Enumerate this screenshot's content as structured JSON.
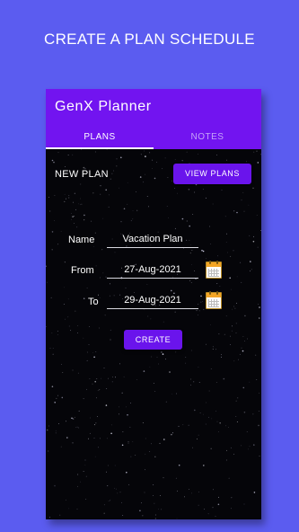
{
  "caption": "CREATE A PLAN SCHEDULE",
  "app": {
    "title": "GenX Planner"
  },
  "tabs": [
    {
      "label": "PLANS",
      "active": true
    },
    {
      "label": "NOTES",
      "active": false
    }
  ],
  "plan": {
    "heading": "NEW PLAN",
    "view_button": "VIEW PLANS",
    "name_label": "Name",
    "name_value": "Vacation Plan",
    "from_label": "From",
    "from_value": "27-Aug-2021",
    "to_label": "To",
    "to_value": "29-Aug-2021",
    "create_button": "CREATE"
  },
  "colors": {
    "page_background": "#5b5cf0",
    "app_bar": "#7214f0",
    "button": "#6a14ec",
    "screen_background": "#050509"
  },
  "icons": [
    "calendar-icon",
    "calendar-icon"
  ]
}
